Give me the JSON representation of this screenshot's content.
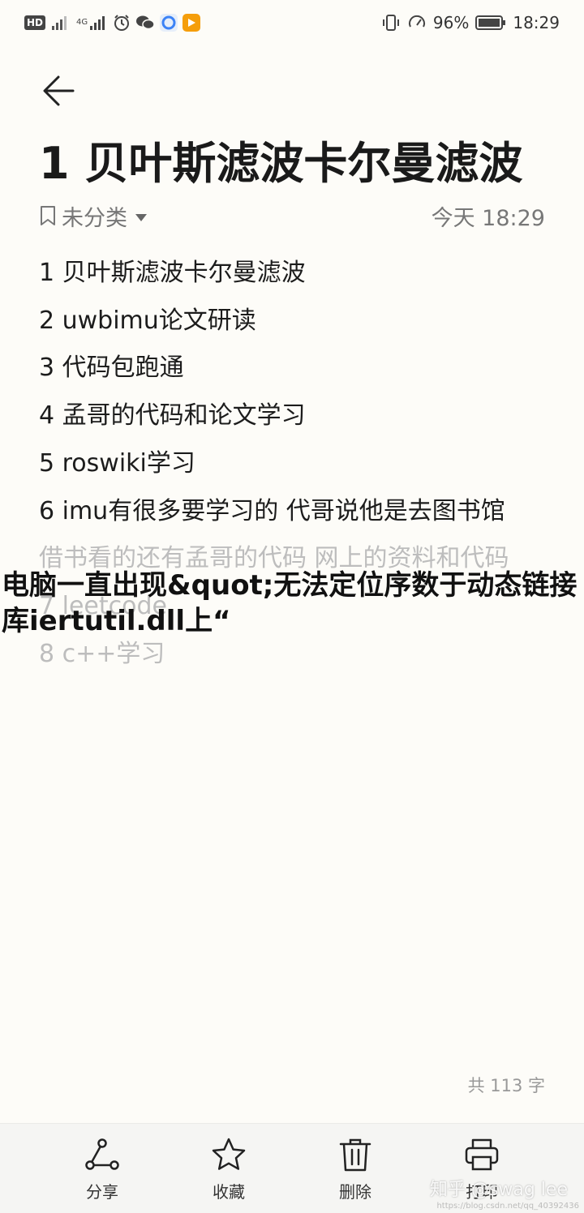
{
  "status_bar": {
    "signal_label_1": "HD",
    "network_badge": "4G",
    "battery_text": "96%",
    "time": "18:29"
  },
  "header": {
    "title": "1 贝叶斯滤波卡尔曼滤波",
    "category": "未分类",
    "timestamp": "今天 18:29"
  },
  "note": {
    "lines": [
      "1 贝叶斯滤波卡尔曼滤波",
      "2 uwbimu论文研读",
      "3 代码包跑通",
      "4 孟哥的代码和论文学习",
      "5 roswiki学习",
      "6 imu有很多要学习的 代哥说他是去图书馆",
      "借书看的还有孟哥的代码 网上的资料和代码",
      "7 leetcode",
      "8 c++学习"
    ],
    "char_count": "共 113 字"
  },
  "overlay": {
    "headline": "电脑一直出现&quot;无法定位序数于动态链接库iertutil.dll上“"
  },
  "toolbar": {
    "share_label": "分享",
    "favorite_label": "收藏",
    "delete_label": "删除",
    "print_label": "打印"
  },
  "watermarks": {
    "zhihu": "知乎 @swag lee",
    "url": "https://blog.csdn.net/qq_40392436"
  },
  "colors": {
    "background": "#fdfcf8",
    "toolbar_bg": "#f5f5f3",
    "faded_text": "#bdbdbd"
  }
}
